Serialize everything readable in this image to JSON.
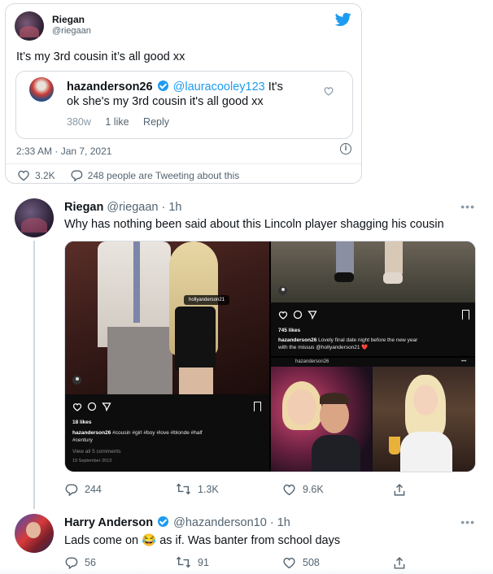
{
  "embed": {
    "name": "Riegan",
    "handle": "@riegaan",
    "text": "It’s my 3rd cousin it’s all good xx",
    "quote": {
      "name": "hazanderson26",
      "mention": "@lauracooley123",
      "text_line1_tail": " It's",
      "text_line2": "ok she's my 3rd cousin it's all good xx",
      "age": "380w",
      "likes": "1 like",
      "reply": "Reply"
    },
    "date": "2:33 AM · Jan 7, 2021",
    "info_glyph": "i",
    "likes": "3.2K",
    "tweeting": "248 people are Tweeting about this"
  },
  "tweet1": {
    "name": "Riegan",
    "handle": "@riegaan · 1h",
    "more": "•••",
    "text": "Why has nothing been said about this Lincoln player shagging his cousin",
    "media": {
      "left": {
        "tag": "hollyanderson21",
        "likes": "18 likes",
        "caption_user": "hazanderson26",
        "caption": " #cousin #girl #boy #love #blonde #half",
        "caption2": "#century",
        "comments": "View all 5 comments",
        "date": "19 September 2013"
      },
      "top_right": {
        "likes": "745 likes",
        "caption_user": "hazanderson26",
        "caption": " Lovely final date night before the new year",
        "caption2": "with the missus @hollyanderson21 ❤️"
      },
      "bottom_right": {
        "header_user": "hazanderson26",
        "more": "•••"
      }
    },
    "replies": "244",
    "retweets": "1.3K",
    "likes": "9.6K"
  },
  "tweet2": {
    "name": "Harry Anderson",
    "handle": "@hazanderson10 · 1h",
    "more": "•••",
    "text_before": "Lads come on ",
    "emoji": "😂",
    "text_after": " as if. Was banter from school days",
    "replies": "56",
    "retweets": "91",
    "likes": "508"
  },
  "colors": {
    "accent": "#1d9bf0",
    "muted": "#536471",
    "border": "#d6dbe0"
  },
  "icons": [
    "twitter-bird-icon",
    "verified-badge-icon",
    "heart-icon",
    "info-icon",
    "reply-icon",
    "retweet-icon",
    "share-icon",
    "more-icon"
  ]
}
